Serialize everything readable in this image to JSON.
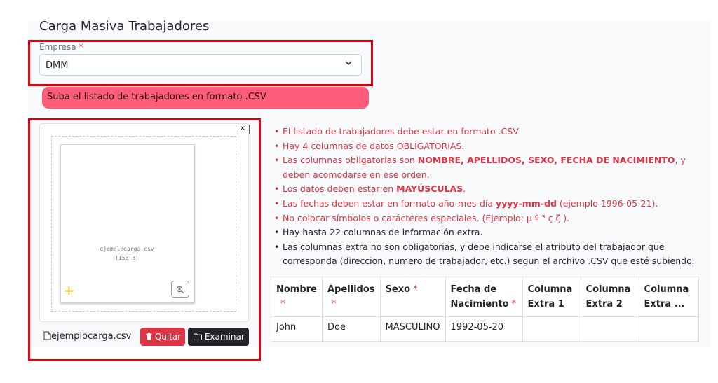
{
  "page": {
    "title": "Carga Masiva Trabajadores"
  },
  "empresa": {
    "label": "Empresa",
    "required_mark": "*",
    "value": "DMM",
    "chevron": "⌄"
  },
  "alert": {
    "text": "Suba el listado de trabajadores en formato .CSV"
  },
  "upload": {
    "close_label": "×",
    "preview_filename": "ejemplocarga.csv",
    "preview_size": "(153 B)",
    "zoom_icon": "⊕",
    "add_icon": "+",
    "file_icon": "🗎",
    "selected_file": "ejemplocarga.csv",
    "remove_icon": "🗑",
    "remove_label": "Quitar",
    "browse_icon": "🗀",
    "browse_label": "Examinar ..."
  },
  "rules": {
    "r1": "El listado de trabajadores debe estar en formato .CSV",
    "r2": "Hay 4 columnas de datos OBLIGATORIAS.",
    "r3_pre": "Las columnas obligatorias son ",
    "r3_bold": "NOMBRE, APELLIDOS, SEXO, FECHA DE NACIMIENTO",
    "r3_post": ", y deben acomodarse en ese orden.",
    "r4_pre": "Los datos deben estar en ",
    "r4_bold": "MAYÚSCULAS",
    "r4_post": ".",
    "r5_pre": "Las fechas deben estar en formato año-mes-día ",
    "r5_bold": "yyyy-mm-dd",
    "r5_post": " (ejemplo 1996-05-21).",
    "r6": "No colocar símbolos o carácteres especiales. (Ejemplo: µ º ³ ç ζ ).",
    "r7": "Hay hasta 22 columnas de información extra.",
    "r8": "Las columnas extra no son obligatorias, y debe indicarse el atributo del trabajador que corresponda (direccion, numero de trabajador, etc.) segun el archivo .CSV que esté subiendo."
  },
  "columns_table": {
    "headers": [
      {
        "label": "Nombre",
        "required": "*"
      },
      {
        "label": "Apellidos",
        "required": "*"
      },
      {
        "label": "Sexo",
        "required": "*"
      },
      {
        "label": "Fecha de Nacimiento",
        "required": "*"
      },
      {
        "label": "Columna Extra 1",
        "required": ""
      },
      {
        "label": "Columna Extra 2",
        "required": ""
      },
      {
        "label": "Columna Extra ...",
        "required": ""
      }
    ],
    "row": [
      "John",
      "Doe",
      "MASCULINO",
      "1992-05-20",
      "",
      "",
      ""
    ]
  }
}
